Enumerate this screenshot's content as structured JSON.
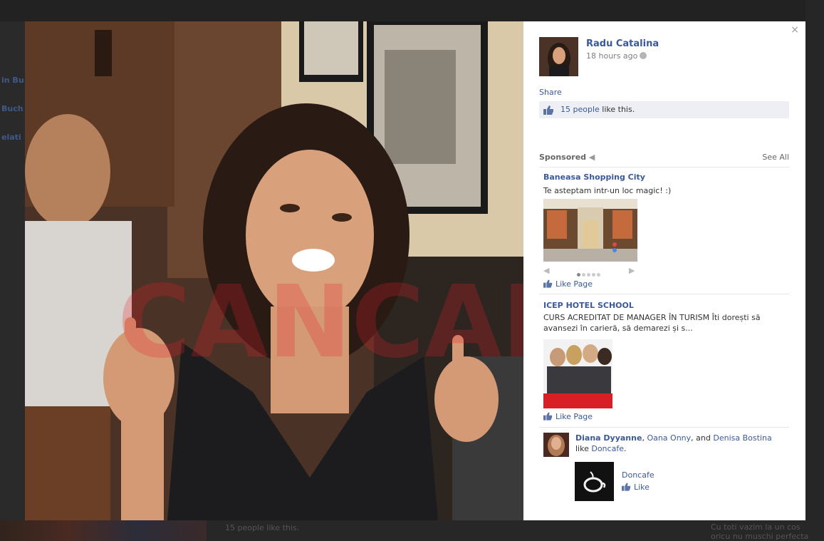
{
  "background": {
    "left_labels": [
      "in Bu",
      "Buch",
      "elati"
    ],
    "bottom_likes": "15 people like this.",
    "bottom_right": "Cu toti vazim la un cos oricu nu muschi perfecta"
  },
  "viewer": {
    "close_label": "×",
    "owner": {
      "name": "Radu Catalina",
      "time": "18 hours ago"
    },
    "share_label": "Share",
    "likes": {
      "link": "15 people",
      "suffix": " like this."
    },
    "sponsored": {
      "label": "Sponsored",
      "see_all": "See All"
    },
    "ads": [
      {
        "title": "Baneasa Shopping City",
        "text": "Te asteptam intr-un loc magic! :)",
        "like_label": "Like Page"
      },
      {
        "title": "ICEP HOTEL SCHOOL",
        "text": "CURS ACREDITAT DE MANAGER ÎN TURISM Îti dorești să avansezi în carieră, să demarezi și s...",
        "like_label": "Like Page"
      }
    ],
    "friends_like": {
      "friend1": "Diana Dyyanne",
      "sep1": ", ",
      "friend2": "Oana Onny",
      "sep2": ", and ",
      "friend3": "Denisa Bostina",
      "line2_prefix": "like ",
      "page": "Doncafe",
      "line2_suffix": ".",
      "page_name": "Doncafe",
      "like_label": "Like"
    }
  },
  "colors": {
    "link": "#3b5998",
    "likes_bar": "#edeff4",
    "overlay": "#1b1b1b"
  }
}
